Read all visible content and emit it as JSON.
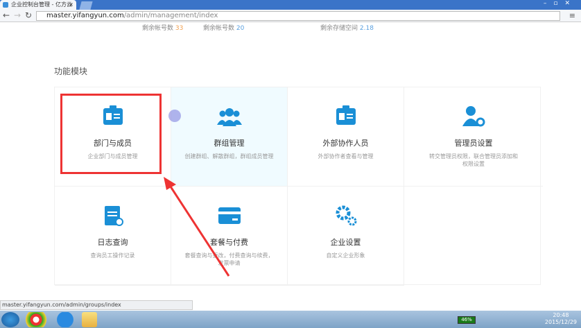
{
  "browser": {
    "tab_title": "企业控制台管理 - 亿方云",
    "url_host": "master.yifangyun.com",
    "url_path": "/admin/management/index",
    "status_url": "master.yifangyun.com/admin/groups/index"
  },
  "stats": [
    {
      "label": "剩余帐号数",
      "value": "33"
    },
    {
      "label": "剩余帐号数",
      "value": "20"
    },
    {
      "label": "剩余存储空间",
      "value": "2.18"
    }
  ],
  "section_title": "功能模块",
  "modules": [
    {
      "title": "部门与成员",
      "desc": "企业部门与成员管理",
      "icon": "id-card-icon"
    },
    {
      "title": "群组管理",
      "desc": "创建群组、解散群组，群组成员管理",
      "icon": "group-icon"
    },
    {
      "title": "外部协作人员",
      "desc": "外部协作者查看与管理",
      "icon": "id-card-icon"
    },
    {
      "title": "管理员设置",
      "desc": "转交管理员权限，联合管理员添加和权限设置",
      "icon": "admin-gear-icon"
    },
    {
      "title": "日志查询",
      "desc": "查询员工操作记录",
      "icon": "log-search-icon"
    },
    {
      "title": "套餐与付费",
      "desc": "套餐查询与更改，付费查询与续费，发票申请",
      "icon": "card-icon"
    },
    {
      "title": "企业设置",
      "desc": "自定义企业形象",
      "icon": "gears-icon"
    }
  ],
  "taskbar": {
    "battery": "46%",
    "time": "20:48",
    "date": "2015/12/29"
  },
  "colors": {
    "accent": "#1a8fd6",
    "highlight": "#ee3333"
  }
}
